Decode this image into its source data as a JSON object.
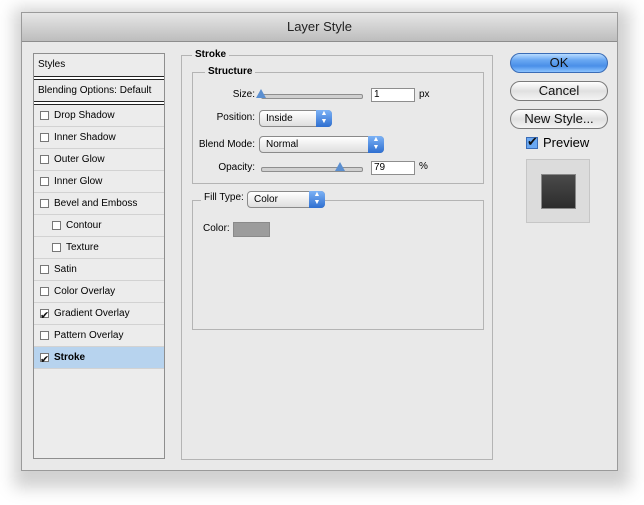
{
  "window": {
    "title": "Layer Style"
  },
  "styles_panel": {
    "header": "Styles",
    "blending_options": "Blending Options: Default",
    "items": [
      {
        "label": "Drop Shadow",
        "checked": false,
        "indent": false,
        "selected": false
      },
      {
        "label": "Inner Shadow",
        "checked": false,
        "indent": false,
        "selected": false
      },
      {
        "label": "Outer Glow",
        "checked": false,
        "indent": false,
        "selected": false
      },
      {
        "label": "Inner Glow",
        "checked": false,
        "indent": false,
        "selected": false
      },
      {
        "label": "Bevel and Emboss",
        "checked": false,
        "indent": false,
        "selected": false
      },
      {
        "label": "Contour",
        "checked": false,
        "indent": true,
        "selected": false
      },
      {
        "label": "Texture",
        "checked": false,
        "indent": true,
        "selected": false
      },
      {
        "label": "Satin",
        "checked": false,
        "indent": false,
        "selected": false
      },
      {
        "label": "Color Overlay",
        "checked": false,
        "indent": false,
        "selected": false
      },
      {
        "label": "Gradient Overlay",
        "checked": true,
        "indent": false,
        "selected": false
      },
      {
        "label": "Pattern Overlay",
        "checked": false,
        "indent": false,
        "selected": false
      },
      {
        "label": "Stroke",
        "checked": true,
        "indent": false,
        "selected": true
      }
    ]
  },
  "stroke": {
    "group_title": "Stroke",
    "structure_title": "Structure",
    "size_label": "Size:",
    "size_value": "1",
    "size_unit": "px",
    "size_slider_fraction": 0.0,
    "position_label": "Position:",
    "position_value": "Inside",
    "blend_mode_label": "Blend Mode:",
    "blend_mode_value": "Normal",
    "opacity_label": "Opacity:",
    "opacity_value": "79",
    "opacity_unit": "%",
    "opacity_slider_fraction": 0.79,
    "fill_type_label": "Fill Type:",
    "fill_type_value": "Color",
    "color_label": "Color:",
    "color_swatch": "#9c9c9c"
  },
  "buttons": {
    "ok": "OK",
    "cancel": "Cancel",
    "new_style": "New Style..."
  },
  "preview": {
    "label": "Preview",
    "checked": true
  },
  "colors": {
    "accent": "#5b8fd0",
    "selected_row": "#b7d3ee"
  }
}
